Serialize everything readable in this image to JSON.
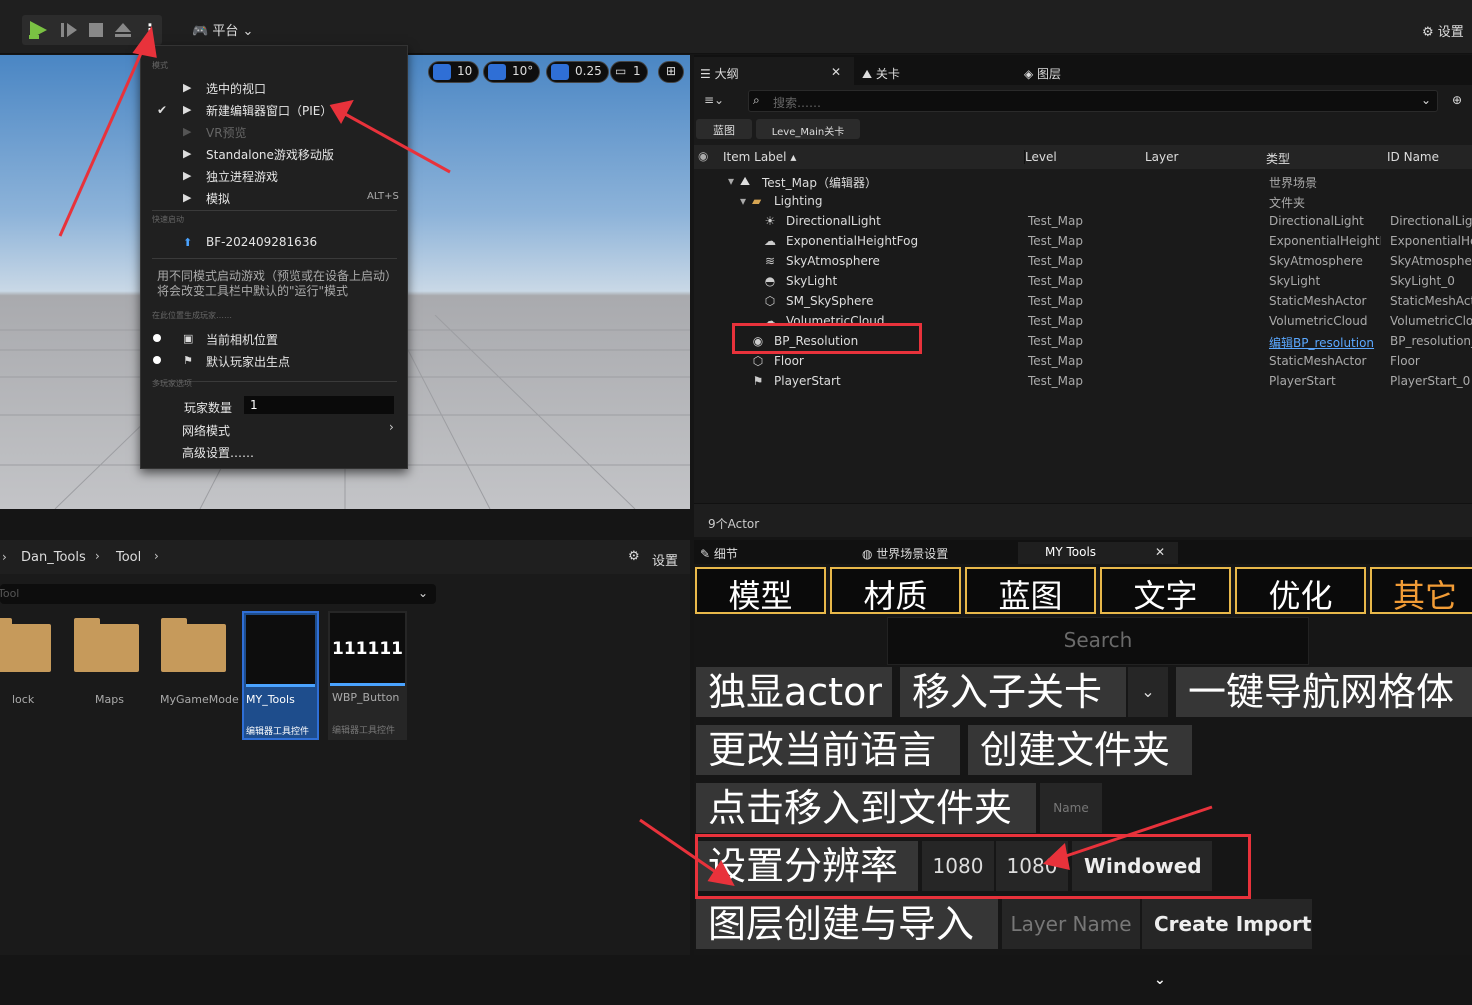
{
  "toolbar": {
    "platform_label": "平台",
    "settings_label": "设置"
  },
  "viewport": {
    "grid_snap": "10",
    "rotation_snap": "10°",
    "scale_snap": "0.25",
    "camera_speed": "1"
  },
  "play_menu": {
    "section_mode": "模式",
    "items": [
      {
        "label": "选中的视口",
        "checked": false,
        "dim": false
      },
      {
        "label": "新建编辑器窗口（PIE）",
        "checked": true,
        "dim": false
      },
      {
        "label": "VR预览",
        "checked": false,
        "dim": true
      },
      {
        "label": "Standalone游戏移动版",
        "checked": false,
        "dim": false
      },
      {
        "label": "独立进程游戏",
        "checked": false,
        "dim": false
      },
      {
        "label": "模拟",
        "checked": false,
        "dim": false
      }
    ],
    "simulate_shortcut": "ALT+S",
    "section_quick": "快速启动",
    "quick_item": "BF-202409281636",
    "hint": "用不同模式启动游戏（预览或在设备上启动）将会改变工具栏中默认的\"运行\"模式",
    "section_spawn": "在此位置生成玩家……",
    "spawn_items": [
      "当前相机位置",
      "默认玩家出生点"
    ],
    "section_multi": "多玩家选项",
    "player_count_label": "玩家数量",
    "player_count_value": "1",
    "net_mode_label": "网络模式",
    "advanced_label": "高级设置……"
  },
  "outliner": {
    "tabs": [
      "大纲",
      "关卡",
      "图层"
    ],
    "search_placeholder": "搜索……",
    "filter_chips": [
      "蓝图",
      "Leve_Main关卡"
    ],
    "columns": [
      "Item Label",
      "Level",
      "Layer",
      "类型",
      "ID Name"
    ],
    "root": {
      "label": "Test_Map（编辑器）",
      "type": "世界场景"
    },
    "folder": {
      "label": "Lighting",
      "type": "文件夹"
    },
    "rows": [
      {
        "label": "DirectionalLight",
        "level": "Test_Map",
        "type": "DirectionalLight",
        "id": "DirectionalLigh",
        "icon": "sun-icon",
        "indent": 2
      },
      {
        "label": "ExponentialHeightFog",
        "level": "Test_Map",
        "type": "ExponentialHeightFc",
        "id": "ExponentialHe",
        "icon": "fog-icon",
        "indent": 2
      },
      {
        "label": "SkyAtmosphere",
        "level": "Test_Map",
        "type": "SkyAtmosphere",
        "id": "SkyAtmospher",
        "icon": "atmosphere-icon",
        "indent": 2
      },
      {
        "label": "SkyLight",
        "level": "Test_Map",
        "type": "SkyLight",
        "id": "SkyLight_0",
        "icon": "skylight-icon",
        "indent": 2
      },
      {
        "label": "SM_SkySphere",
        "level": "Test_Map",
        "type": "StaticMeshActor",
        "id": "StaticMeshAct",
        "icon": "mesh-icon",
        "indent": 2
      },
      {
        "label": "VolumetricCloud",
        "level": "Test_Map",
        "type": "VolumetricCloud",
        "id": "VolumetricClou",
        "icon": "cloud-icon",
        "indent": 2
      },
      {
        "label": "BP_Resolution",
        "level": "Test_Map",
        "type": "编辑BP_resolution",
        "id": "BP_resolution_",
        "icon": "blueprint-icon",
        "indent": 1,
        "type_link": true
      },
      {
        "label": "Floor",
        "level": "Test_Map",
        "type": "StaticMeshActor",
        "id": "Floor",
        "icon": "mesh-icon",
        "indent": 1
      },
      {
        "label": "PlayerStart",
        "level": "Test_Map",
        "type": "PlayerStart",
        "id": "PlayerStart_0",
        "icon": "playerstart-icon",
        "indent": 1
      }
    ],
    "status": "9个Actor"
  },
  "content_browser": {
    "breadcrumb": [
      "Dan_Tools",
      "Tool"
    ],
    "settings_label": "设置",
    "path_value": "Tool",
    "folders": [
      "lock",
      "Maps",
      "MyGameMode"
    ],
    "assets": [
      {
        "name": "MY_Tools",
        "type": "编辑器工具控件",
        "selected": true
      },
      {
        "name": "WBP_Button",
        "type": "编辑器工具控件",
        "selected": false,
        "thumb_text": "111111"
      }
    ]
  },
  "details": {
    "tabs": [
      "细节",
      "世界场景设置",
      "MY Tools"
    ],
    "categories": [
      "模型",
      "材质",
      "蓝图",
      "文字",
      "优化",
      "其它"
    ],
    "search_placeholder": "Search",
    "buttons": {
      "isolate": "独显actor",
      "move_sublevel": "移入子关卡",
      "nav_mesh": "一键导航网格体",
      "change_lang": "更改当前语言",
      "create_folder": "创建文件夹",
      "move_to_folder": "点击移入到文件夹",
      "set_resolution": "设置分辨率",
      "layer_import": "图层创建与导入"
    },
    "name_placeholder": "Name",
    "res_width": "1080",
    "res_height": "1080",
    "window_mode": "Windowed",
    "layer_name_placeholder": "Layer Name",
    "create_import": "Create Import"
  },
  "colors": {
    "accent_blue": "#2f6fd6",
    "play_green": "#7ac143",
    "category_border": "#e8b84a",
    "category_other_text": "#f29c36",
    "annotation_red": "#e8323b"
  }
}
